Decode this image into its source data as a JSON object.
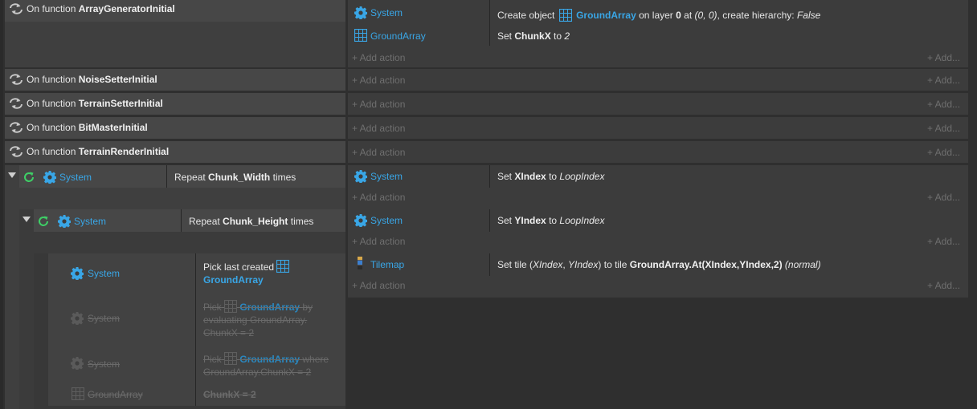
{
  "colors": {
    "accent": "#39a6e6",
    "loop": "#3ecf66",
    "background": "#2f2f2f"
  },
  "functions": [
    {
      "prefix": "On function",
      "name": "ArrayGeneratorInitial"
    },
    {
      "prefix": "On function",
      "name": "NoiseSetterInitial"
    },
    {
      "prefix": "On function",
      "name": "TerrainSetterInitial"
    },
    {
      "prefix": "On function",
      "name": "BitMasterInitial"
    },
    {
      "prefix": "On function",
      "name": "TerrainRenderInitial"
    }
  ],
  "add_action": "+ Add action",
  "add_more": "+ Add...",
  "actions_fn1": [
    {
      "object": "System",
      "pre": "Create object",
      "obj": "GroundArray",
      "mid1": "on layer",
      "layer": "0",
      "mid2": "at",
      "pos": "(0, 0)",
      "mid3": ", create hierarchy:",
      "hier": "False"
    },
    {
      "object": "GroundArray",
      "pre": "Set",
      "var": "ChunkX",
      "mid": "to",
      "val": "2"
    }
  ],
  "loop1": {
    "object": "System",
    "pre": "Repeat",
    "var": "Chunk_Width",
    "post": "times",
    "action": {
      "object": "System",
      "pre": "Set",
      "var": "XIndex",
      "mid": "to",
      "val": "LoopIndex"
    }
  },
  "loop2": {
    "object": "System",
    "pre": "Repeat",
    "var": "Chunk_Height",
    "post": "times",
    "action": {
      "object": "System",
      "pre": "Set",
      "var": "YIndex",
      "mid": "to",
      "val": "LoopIndex"
    }
  },
  "inner": {
    "conditions": [
      {
        "object": "System",
        "pre": "Pick last created",
        "obj": "GroundArray"
      },
      {
        "object": "System",
        "pre": "Pick",
        "obj": "GroundArray",
        "line1_post": "by",
        "line2": "evaluating GroundArray.",
        "line3": "ChunkX = 2"
      },
      {
        "object": "System",
        "pre": "Pick",
        "obj": "GroundArray",
        "line1_post": "where",
        "line2": "GroundArray.ChunkX = 2"
      },
      {
        "object": "GroundArray",
        "text": "ChunkX = 2"
      }
    ],
    "action": {
      "object": "Tilemap",
      "pre": "Set tile (",
      "x": "XIndex",
      "comma": ", ",
      "y": "YIndex",
      "mid": ") to tile",
      "expr": "GroundArray.At(XIndex,YIndex,2)",
      "mode": "(normal)"
    }
  }
}
